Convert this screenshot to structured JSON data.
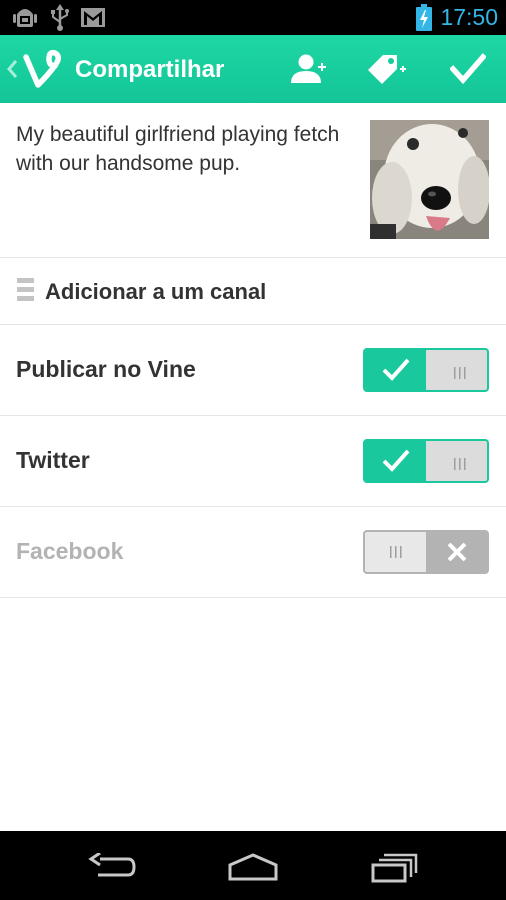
{
  "status_bar": {
    "time": "17:50",
    "left_icons": [
      "android-debug-icon",
      "usb-icon",
      "gmail-icon"
    ],
    "right_icons": [
      "battery-charging-icon"
    ]
  },
  "app_bar": {
    "title": "Compartilhar",
    "icons": [
      "back-chevron-icon",
      "vine-logo-icon",
      "add-person-icon",
      "add-tag-icon",
      "checkmark-icon"
    ],
    "background_color": "#1ed7a3"
  },
  "post": {
    "caption": "My beautiful girlfriend playing fetch with our handsome pup.",
    "thumbnail": "dog-photo"
  },
  "channel": {
    "label": "Adicionar a um canal",
    "icon": "list-handle-icon"
  },
  "share_options": [
    {
      "label": "Publicar no Vine",
      "enabled": true
    },
    {
      "label": "Twitter",
      "enabled": true
    },
    {
      "label": "Facebook",
      "enabled": false
    }
  ],
  "colors": {
    "accent": "#19c89c",
    "text_primary": "#333333",
    "text_disabled": "#b3b3b3",
    "status_clock": "#33b5e5"
  },
  "nav_bar": {
    "icons": [
      "back-icon",
      "home-icon",
      "recents-icon"
    ]
  }
}
